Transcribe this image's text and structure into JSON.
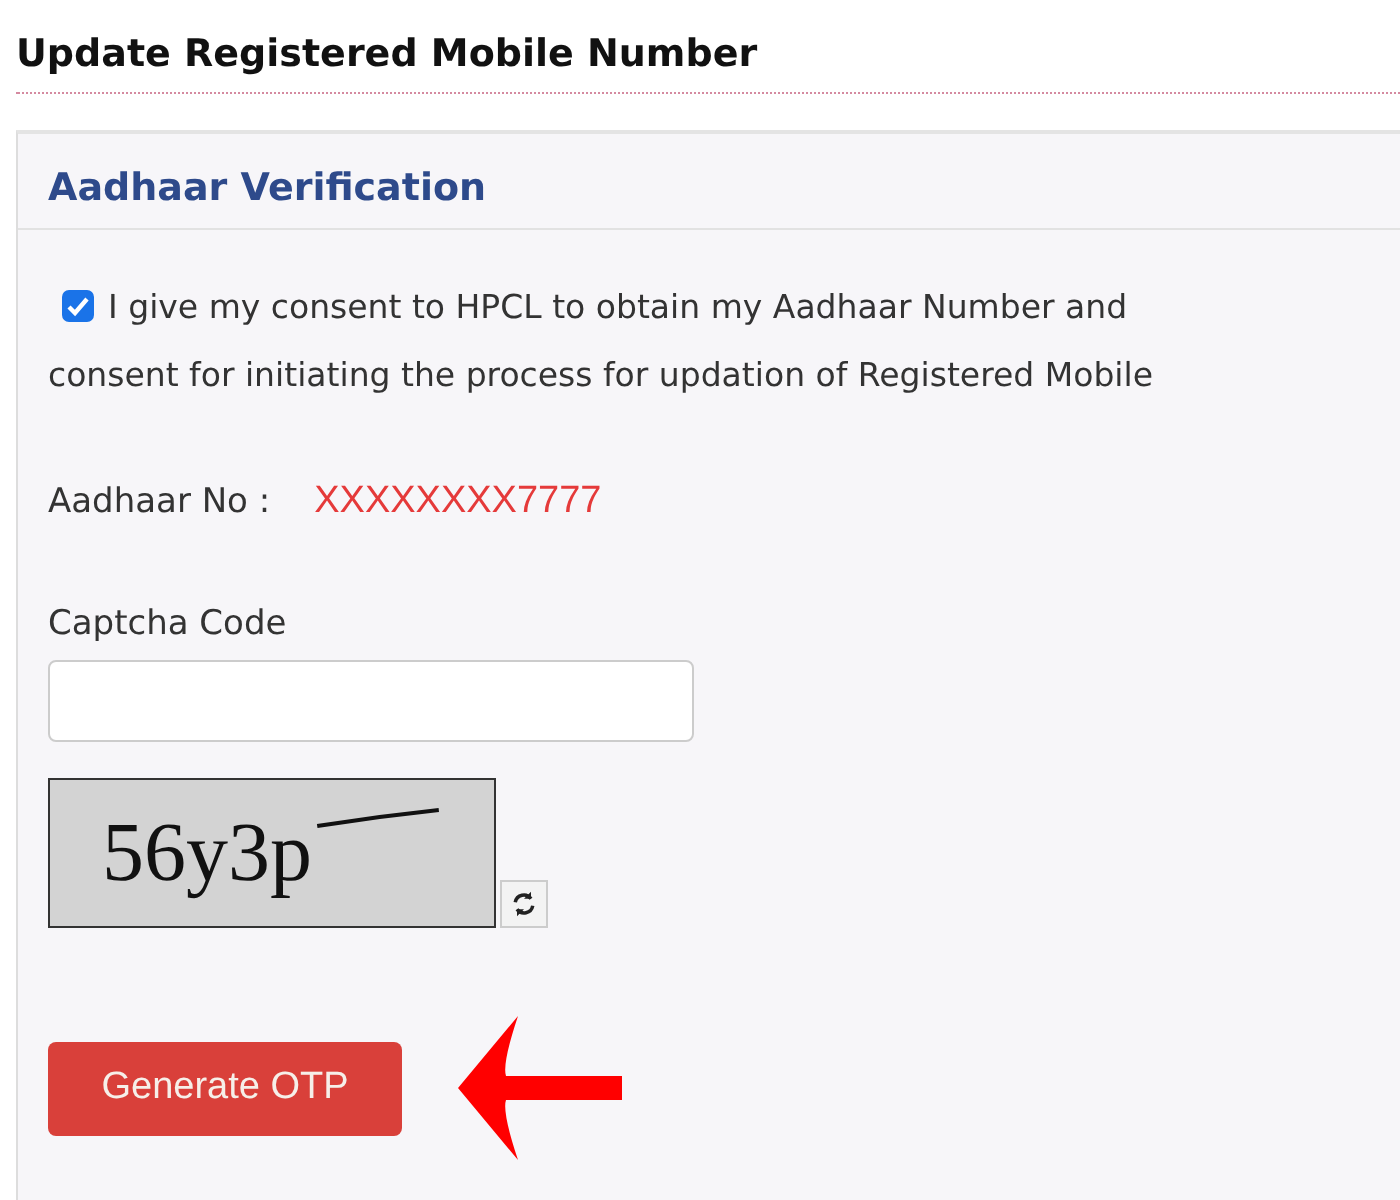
{
  "page_title": "Update Registered Mobile Number",
  "section": {
    "title": "Aadhaar Verification",
    "consent": {
      "checked": true,
      "lines": [
        "I give my consent to HPCL to obtain my Aadhaar Number and",
        "consent for initiating the process for updation of Registered Mobile"
      ]
    },
    "aadhaar": {
      "label": "Aadhaar No :",
      "value": "XXXXXXXX7777"
    },
    "captcha": {
      "label": "Captcha Code",
      "code": "56y3p"
    },
    "button": "Generate OTP"
  }
}
